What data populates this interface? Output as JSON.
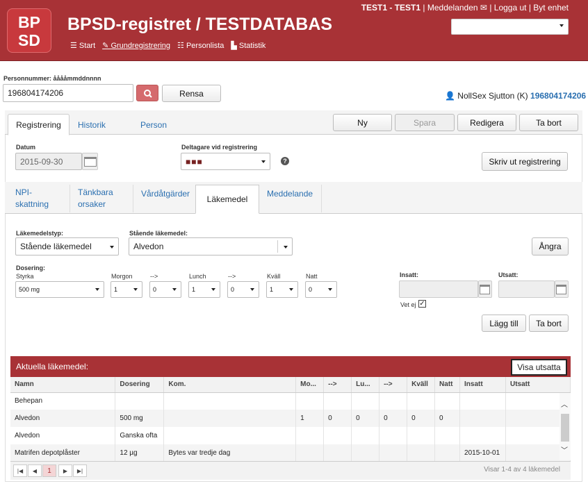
{
  "header": {
    "logo_line1": "BP",
    "logo_line2": "SD",
    "title": "BPSD-registret / TESTDATABAS",
    "nav": [
      "Start",
      "Grundregistrering",
      "Personlista",
      "Statistik"
    ],
    "unit": "TEST1 - TEST1",
    "messages": "Meddelanden",
    "logout": "Logga ut",
    "switch_unit": "Byt enhet"
  },
  "search": {
    "label": "Personnummer: ååååmmddnnnn",
    "value": "196804174206",
    "clear": "Rensa"
  },
  "patient": {
    "name": "NollSex Sjutton (K)",
    "pnr": "196804174206"
  },
  "tabs": [
    "Registrering",
    "Historik",
    "Person"
  ],
  "actions": {
    "new": "Ny",
    "save": "Spara",
    "edit": "Redigera",
    "delete": "Ta bort"
  },
  "form": {
    "date_label": "Datum",
    "date_value": "2015-09-30",
    "participants_label": "Deltagare vid registrering",
    "participants_value": "■■■",
    "print": "Skriv ut registrering"
  },
  "subtabs": [
    {
      "l1": "NPI-",
      "l2": "skattning"
    },
    {
      "l1": "Tänkbara",
      "l2": "orsaker"
    },
    {
      "l1": "Vårdåtgärder",
      "l2": ""
    },
    {
      "l1": "Läkemedel",
      "l2": ""
    },
    {
      "l1": "Meddelande",
      "l2": ""
    }
  ],
  "med": {
    "type_label": "Läkemedelstyp:",
    "type_value": "Stående läkemedel",
    "standing_label": "Stående läkemedel:",
    "standing_value": "Alvedon",
    "undo": "Ångra",
    "dosing_label": "Dosering:",
    "strength_label": "Styrka",
    "strength_value": "500 mg",
    "morning_label": "Morgon",
    "morning_value": "1",
    "arrow": "-->",
    "lunch_label": "Lunch",
    "lunch_value": "1",
    "evening_label": "Kväll",
    "evening_value": "1",
    "night_label": "Natt",
    "night_value": "0",
    "between1_value": "0",
    "between2_value": "0",
    "start_label": "Insatt:",
    "stop_label": "Utsatt:",
    "unknown_label": "Vet ej",
    "add": "Lägg till",
    "remove": "Ta bort"
  },
  "current": {
    "title": "Aktuella läkemedel:",
    "show_stopped": "Visa utsatta",
    "columns": [
      "Namn",
      "Dosering",
      "Kom.",
      "Mo...",
      "-->",
      "Lu...",
      "-->",
      "Kväll",
      "Natt",
      "Insatt",
      "Utsatt"
    ],
    "rows": [
      [
        "Behepan",
        "",
        "",
        "",
        "",
        "",
        "",
        "",
        "",
        "",
        ""
      ],
      [
        "Alvedon",
        "500 mg",
        "",
        "1",
        "0",
        "0",
        "0",
        "0",
        "0",
        "",
        ""
      ],
      [
        "Alvedon",
        "Ganska ofta",
        "",
        "",
        "",
        "",
        "",
        "",
        "",
        "",
        ""
      ],
      [
        "Matrifen depotplåster",
        "12 µg",
        "Bytes var tredje dag",
        "",
        "",
        "",
        "",
        "",
        "",
        "2015-10-01",
        ""
      ]
    ],
    "page": "1",
    "page_info": "Visar 1-4 av 4 läkemedel"
  }
}
